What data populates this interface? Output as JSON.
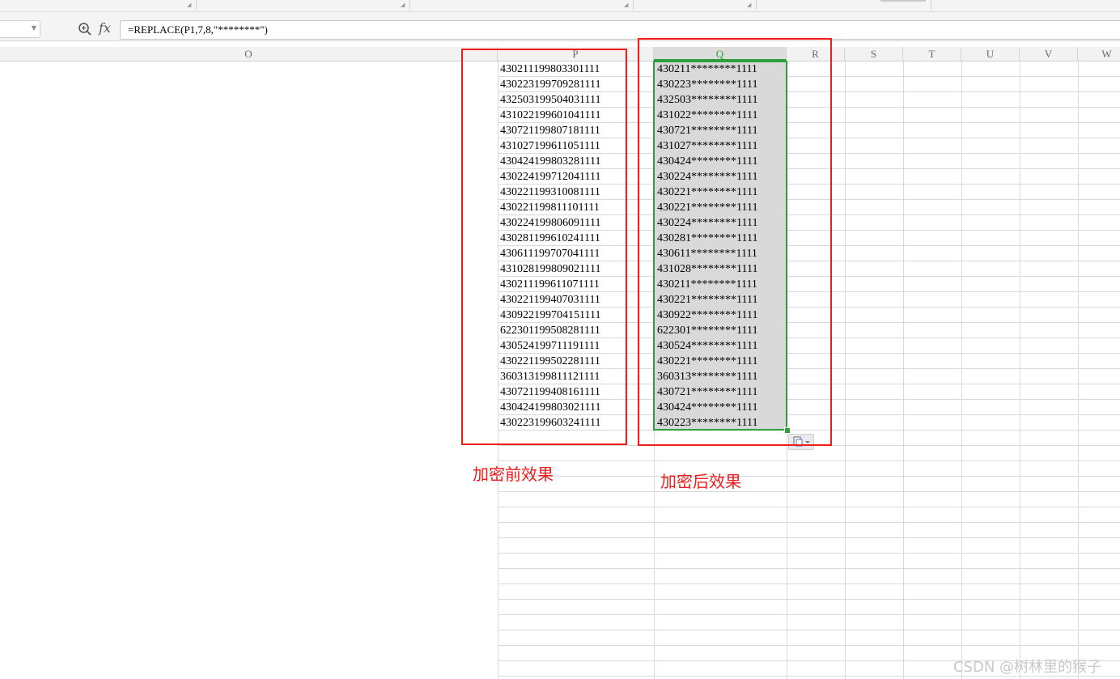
{
  "formula_bar": {
    "fx_label": "fx",
    "formula": "=REPLACE(P1,7,8,\"********\")"
  },
  "columns": [
    "O",
    "P",
    "Q",
    "R",
    "S",
    "T",
    "U",
    "V",
    "W"
  ],
  "active_column": "Q",
  "column_p_values": [
    "430211199803301111",
    "430223199709281111",
    "432503199504031111",
    "431022199601041111",
    "430721199807181111",
    "431027199611051111",
    "430424199803281111",
    "430224199712041111",
    "430221199310081111",
    "430221199811101111",
    "430224199806091111",
    "430281199610241111",
    "430611199707041111",
    "431028199809021111",
    "430211199611071111",
    "430221199407031111",
    "430922199704151111",
    "622301199508281111",
    "430524199711191111",
    "430221199502281111",
    "360313199811121111",
    "430721199408161111",
    "430424199803021111",
    "430223199603241111"
  ],
  "column_q_values": [
    "430211********1111",
    "430223********1111",
    "432503********1111",
    "431022********1111",
    "430721********1111",
    "431027********1111",
    "430424********1111",
    "430224********1111",
    "430221********1111",
    "430221********1111",
    "430224********1111",
    "430281********1111",
    "430611********1111",
    "431028********1111",
    "430211********1111",
    "430221********1111",
    "430922********1111",
    "622301********1111",
    "430524********1111",
    "430221********1111",
    "360313********1111",
    "430721********1111",
    "430424********1111",
    "430223********1111"
  ],
  "annotations": {
    "before_label": "加密前效果",
    "after_label": "加密后效果",
    "accent_color": "#f01c1c",
    "selection_color": "#2e9e3c"
  },
  "watermark": "CSDN @树林里的猴子",
  "icons": {
    "zoom": "zoom-formula-icon",
    "paste_options": "paste-options-icon",
    "name_box_dropdown": "chevron-down-icon"
  }
}
